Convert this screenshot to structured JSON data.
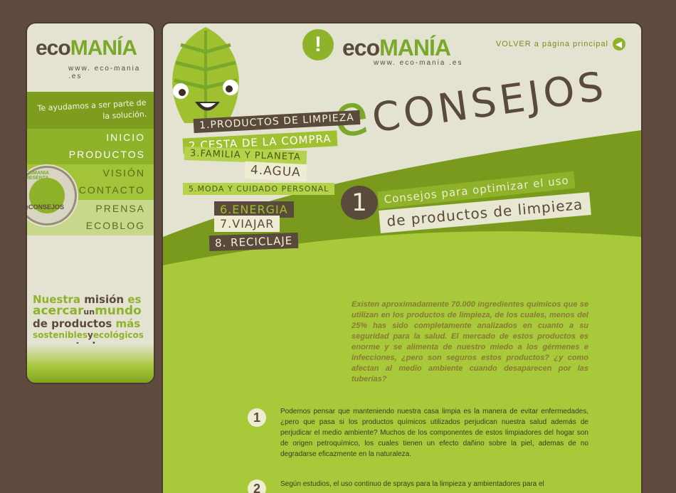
{
  "sidebar": {
    "logo": {
      "eco": "eco",
      "mania": "MANÍA",
      "url": "www. eco-mania .es"
    },
    "tagline": "Te ayudamos a ser parte de la solución.",
    "nav": [
      "INICIO",
      "PRODUCTOS",
      "VISIÓN",
      "CONTACTO",
      "PRENSA",
      "ECOBLOG"
    ],
    "badge": {
      "top": "ECOMANIA PRESENTA",
      "bottom": "eCONSEJOS"
    },
    "mission": {
      "line1a": "Nuestra",
      "line1b": "misión",
      "line1c": "es",
      "line2a": "acercar",
      "line2b": "un",
      "line2c": "mundo",
      "line3a": "de",
      "line3b": "productos",
      "line3c": "más",
      "line4a": "sostenibles",
      "line4b": "y",
      "line4c": "ecológicos",
      "line5a": "a",
      "line5b": "tu hogar"
    }
  },
  "header": {
    "bubble": "!",
    "logo": {
      "eco": "eco",
      "mania": "MANÍA",
      "url": "www. eco-mania .es"
    },
    "back_link": "VOLVER a página principal",
    "title_e": "e",
    "title_rest": "CONSEJOS"
  },
  "menu": [
    "1.PRODUCTOS DE LIMPIEZA",
    "2.CESTA DE LA COMPRA",
    "3.FAMILIA Y PLANETA",
    "4.AGUA",
    "5.MODA Y CUIDADO PERSONAL",
    "6.ENERGIA",
    "7.VIAJAR",
    "8. RECICLAJE"
  ],
  "section": {
    "number": "1",
    "title_line1": "Consejos para optimizar el uso",
    "title_line2": "de productos de limpieza"
  },
  "intro": "Existen aproximadamente 70.000 ingredientes quimicos que se utilizan en los productos de limpieza, de los cuales, menos del 25% has sido completamente analizados en cuanto a su seguridad para la salud. El mercado de estos productos es enorme y se alimenta de nuestro miedo a los gérmenes e infecciones, ¿pero son seguros estos productos? ¿y como afectan al medio ambiente cuando desaparecen por las tuberías?",
  "tips": [
    {
      "num": "1",
      "text": "Podemos pensar que manteniendo nuestra casa limpia es la manera de evitar enfermedades, ¿pero que pasa si los productos químicos utilizados perjudican nuestra salud además de perjudicar el medio ambiente? Muchos de los componentes de estos limpiadores del hogar son de origen petroquímico, los cuales tienen un efecto dañino sobre la piel, ademas de no degradarse eficazmente en la naturaleza."
    },
    {
      "num": "2",
      "text": "Según estudios, el uso continuo de sprays para la limpieza y ambientadores para el"
    }
  ]
}
